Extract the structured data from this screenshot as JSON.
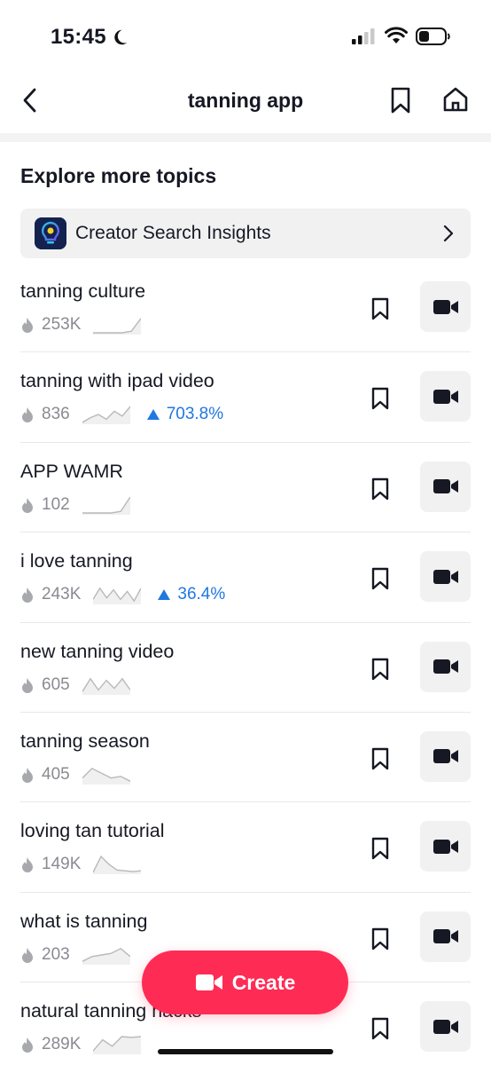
{
  "status_bar": {
    "time": "15:45"
  },
  "header": {
    "title": "tanning app"
  },
  "section": {
    "title": "Explore more topics"
  },
  "insights": {
    "label": "Creator Search Insights"
  },
  "topics": [
    {
      "title": "tanning culture",
      "views": "253K",
      "trend": "",
      "spark": [
        0,
        0,
        0,
        0,
        0.1,
        0.9
      ]
    },
    {
      "title": "tanning with ipad video",
      "views": "836",
      "trend": "703.8%",
      "spark": [
        0,
        0.3,
        0.5,
        0.2,
        0.7,
        0.4,
        1
      ]
    },
    {
      "title": "APP WAMR",
      "views": "102",
      "trend": "",
      "spark": [
        0,
        0,
        0,
        0,
        0.1,
        1
      ]
    },
    {
      "title": "i love tanning",
      "views": "243K",
      "trend": "36.4%",
      "spark": [
        0.2,
        0.9,
        0.3,
        0.8,
        0.2,
        0.7,
        0.1,
        0.9
      ]
    },
    {
      "title": "new tanning video",
      "views": "605",
      "trend": "",
      "spark": [
        0.1,
        0.9,
        0.2,
        0.8,
        0.3,
        0.9,
        0.2
      ]
    },
    {
      "title": "tanning season",
      "views": "405",
      "trend": "",
      "spark": [
        0.3,
        0.9,
        0.6,
        0.3,
        0.4,
        0.1
      ]
    },
    {
      "title": "loving tan tutorial",
      "views": "149K",
      "trend": "",
      "spark": [
        0,
        1,
        0.5,
        0.15,
        0.1,
        0.05,
        0.1
      ]
    },
    {
      "title": "what is tanning",
      "views": "203",
      "trend": "",
      "spark": [
        0.1,
        0.4,
        0.5,
        0.6,
        0.9,
        0.4
      ]
    },
    {
      "title": "natural tanning hacks",
      "views": "289K",
      "trend": "",
      "spark": [
        0.1,
        0.8,
        0.4,
        1,
        0.95,
        1
      ]
    }
  ],
  "create_button": {
    "label": "Create"
  },
  "icons": {
    "back": "chevron-left-icon",
    "bookmark": "bookmark-icon",
    "home": "home-icon",
    "video": "video-camera-icon",
    "flame": "flame-icon",
    "trend_up": "triangle-up-icon"
  },
  "colors": {
    "accent": "#fe2c55",
    "trend": "#1f78e0",
    "muted": "#8a8b91"
  }
}
